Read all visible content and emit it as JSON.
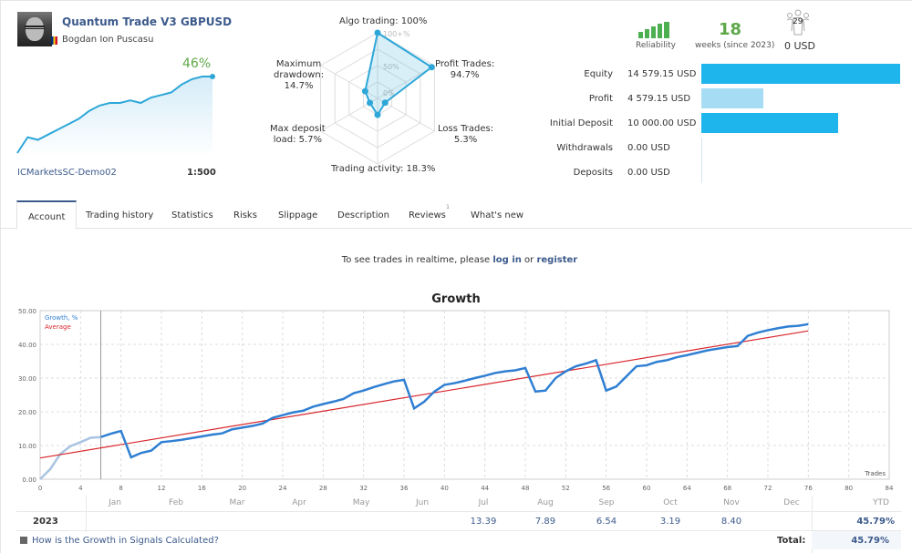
{
  "header": {
    "signal_title": "Quantum Trade V3 GBPUSD",
    "author": "Bogdan Ion Puscasu",
    "growth_pct": "46%",
    "broker": "ICMarketsSC-Demo02",
    "leverage": "1:500"
  },
  "mini_chart": {
    "values": [
      0,
      6,
      5,
      7,
      9,
      11,
      13,
      16,
      18,
      19,
      19,
      20,
      19,
      21,
      22,
      23,
      26,
      28,
      29,
      29
    ]
  },
  "radar": {
    "axes": [
      {
        "label": "Algo trading: 100%",
        "value": 100
      },
      {
        "label": "Profit Trades: 94.7%",
        "value": 94.7
      },
      {
        "label": "Loss Trades: 5.3%",
        "value": 5.3
      },
      {
        "label": "Trading activity: 18.3%",
        "value": 18.3
      },
      {
        "label": "Max deposit load: 5.7%",
        "value": 5.7
      },
      {
        "label": "Maximum drawdown: 14.7%",
        "value": 14.7
      }
    ],
    "label_lines": {
      "algo": "Algo trading: 100%",
      "profit": [
        "Profit Trades:",
        "94.7%"
      ],
      "loss": [
        "Loss Trades:",
        "5.3%"
      ],
      "activity": "Trading activity: 18.3%",
      "deposit_load": [
        "Max deposit",
        "load: 5.7%"
      ],
      "drawdown": [
        "Maximum",
        "drawdown:",
        "14.7%"
      ]
    },
    "scale_labels": [
      "100+%",
      "50%",
      "0%"
    ]
  },
  "stats": {
    "reliability_label": "Reliability",
    "weeks": "18",
    "weeks_label": "weeks (since 2023)",
    "subscribers": "29",
    "subscription_price": "0 USD"
  },
  "financials": [
    {
      "label": "Equity",
      "value": "14 579.15 USD",
      "amount": 14579.15,
      "color": "#1eb5ec"
    },
    {
      "label": "Profit",
      "value": "4 579.15 USD",
      "amount": 4579.15,
      "color": "#a6dcf4"
    },
    {
      "label": "Initial Deposit",
      "value": "10 000.00 USD",
      "amount": 10000.0,
      "color": "#1eb5ec"
    },
    {
      "label": "Withdrawals",
      "value": "0.00 USD",
      "amount": 0,
      "color": "#1eb5ec"
    },
    {
      "label": "Deposits",
      "value": "0.00 USD",
      "amount": 0,
      "color": "#1eb5ec"
    }
  ],
  "tabs": [
    {
      "label": "Account",
      "active": true
    },
    {
      "label": "Trading history"
    },
    {
      "label": "Statistics"
    },
    {
      "label": "Risks"
    },
    {
      "label": "Slippage"
    },
    {
      "label": "Description"
    },
    {
      "label": "Reviews",
      "badge": "1"
    },
    {
      "label": "What's new"
    }
  ],
  "realtime": {
    "prefix": "To see trades in realtime, please ",
    "login": "log in",
    "or": " or ",
    "register": "register"
  },
  "chart_data": {
    "type": "line",
    "title": "Growth",
    "xlabel": "Trades",
    "ylabel": "",
    "xlim": [
      0,
      84
    ],
    "ylim": [
      0,
      50
    ],
    "x_ticks": [
      0,
      4,
      8,
      12,
      16,
      20,
      24,
      28,
      32,
      36,
      40,
      44,
      48,
      52,
      56,
      60,
      64,
      68,
      72,
      76,
      80,
      84
    ],
    "y_ticks": [
      "0.00",
      "10.00",
      "20.00",
      "30.00",
      "40.00",
      "50.00"
    ],
    "grid": true,
    "legend": [
      "Growth, %",
      "Average"
    ],
    "legend_position": "top-left",
    "marker_line_x": 6,
    "series": [
      {
        "name": "Growth, %",
        "color": "#2f7fd3",
        "faded_until": 6,
        "values": [
          0,
          3,
          7.5,
          9.8,
          11,
          12.3,
          12.5,
          13.5,
          14.3,
          6.5,
          7.8,
          8.5,
          11,
          11.3,
          11.7,
          12.2,
          12.7,
          13.2,
          13.6,
          14.8,
          15.3,
          15.8,
          16.5,
          18.2,
          19,
          19.8,
          20.3,
          21.5,
          22.3,
          23,
          23.8,
          25.5,
          26.3,
          27.3,
          28.2,
          29,
          29.5,
          21,
          23,
          26,
          28,
          28.5,
          29.2,
          30,
          30.7,
          31.5,
          32,
          32.3,
          33,
          26,
          26.3,
          30,
          32,
          33.5,
          34.3,
          35.3,
          26.3,
          27.5,
          30.5,
          33.5,
          33.8,
          34.8,
          35.3,
          36.2,
          36.8,
          37.5,
          38.2,
          38.7,
          39.2,
          39.5,
          42.5,
          43.5,
          44.2,
          44.8,
          45.3,
          45.5,
          46
        ]
      },
      {
        "name": "Average",
        "color": "#d9262c",
        "values_endpoints": [
          [
            0,
            6.3
          ],
          [
            76,
            44
          ]
        ]
      }
    ]
  },
  "monthly_table": {
    "months": [
      "Jan",
      "Feb",
      "Mar",
      "Apr",
      "May",
      "Jun",
      "Jul",
      "Aug",
      "Sep",
      "Oct",
      "Nov",
      "Dec"
    ],
    "ytd_header": "YTD",
    "year": "2023",
    "values": [
      "",
      "",
      "",
      "",
      "",
      "",
      "13.39",
      "7.89",
      "6.54",
      "3.19",
      "8.40",
      ""
    ],
    "ytd": "45.79%",
    "total_label": "Total:",
    "total": "45.79%",
    "help_link": "How is the Growth in Signals Calculated?"
  }
}
